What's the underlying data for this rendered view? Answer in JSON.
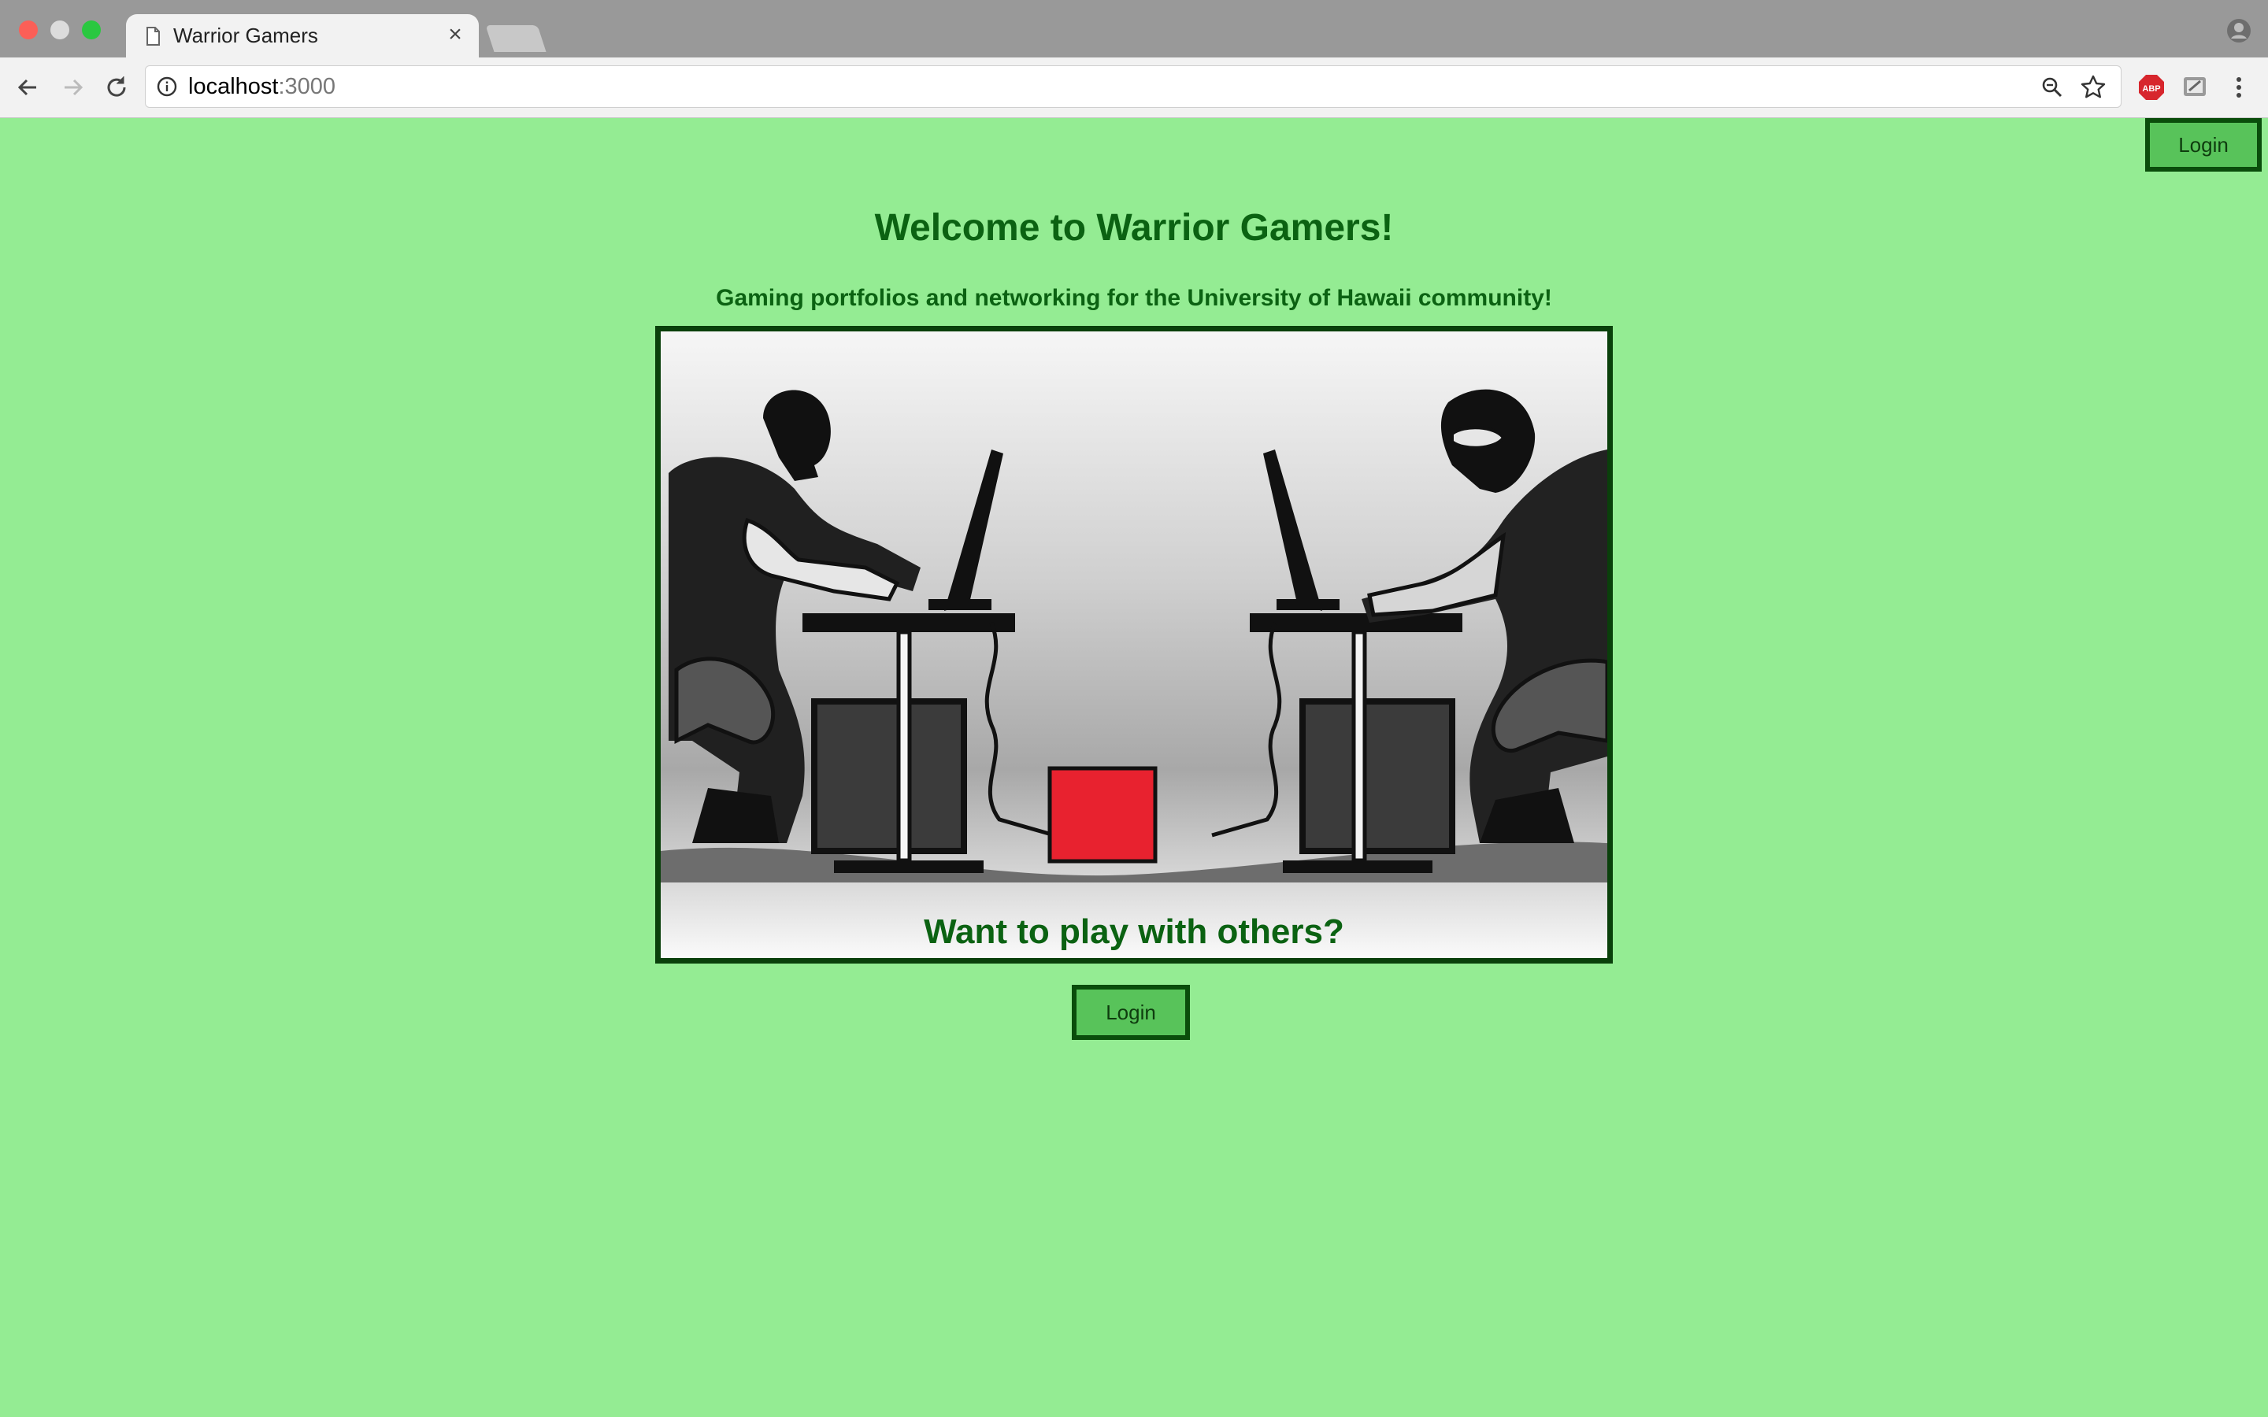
{
  "browser": {
    "tab_title": "Warrior Gamers",
    "tab_close": "×",
    "url_host": "localhost",
    "url_port": ":3000",
    "extension_abp_label": "ABP"
  },
  "page": {
    "top_login_label": "Login",
    "headline": "Welcome to Warrior Gamers!",
    "subheadline": "Gaming portfolios and networking for the University of Hawaii community!",
    "hero_caption": "Want to play with others?",
    "center_login_label": "Login"
  },
  "colors": {
    "background": "#94ec93",
    "text_green": "#0b6212",
    "button_fill": "#58c35a",
    "button_border": "#0a4d0b",
    "hero_red_box": "#e8222f"
  },
  "icons": [
    "document-icon",
    "close-icon",
    "back-icon",
    "forward-icon",
    "reload-icon",
    "info-icon",
    "zoom-icon",
    "star-icon",
    "adblock-icon",
    "extension-icon",
    "menu-icon",
    "profile-icon"
  ]
}
